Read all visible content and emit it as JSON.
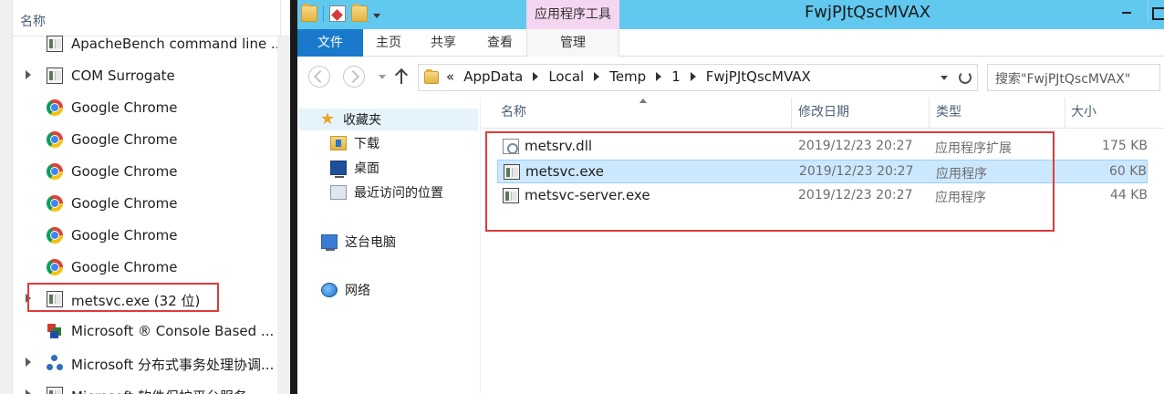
{
  "task_manager": {
    "column_header": "名称",
    "rows": [
      {
        "name": "ApacheBench command line ...",
        "icon": "app-window-icon",
        "expandable": false
      },
      {
        "name": "COM Surrogate",
        "icon": "app-window-icon",
        "expandable": true
      },
      {
        "name": "Google Chrome",
        "icon": "chrome-icon",
        "expandable": false
      },
      {
        "name": "Google Chrome",
        "icon": "chrome-icon",
        "expandable": false
      },
      {
        "name": "Google Chrome",
        "icon": "chrome-icon",
        "expandable": false
      },
      {
        "name": "Google Chrome",
        "icon": "chrome-icon",
        "expandable": false
      },
      {
        "name": "Google Chrome",
        "icon": "chrome-icon",
        "expandable": false
      },
      {
        "name": "Google Chrome",
        "icon": "chrome-icon",
        "expandable": false
      },
      {
        "name": "metsvc.exe (32 位)",
        "icon": "app-window-icon",
        "expandable": true,
        "highlighted": true
      },
      {
        "name": "Microsoft ® Console Based ...",
        "icon": "ms-console-icon",
        "expandable": false
      },
      {
        "name": "Microsoft 分布式事务处理协调...",
        "icon": "network-nodes-icon",
        "expandable": true
      },
      {
        "name": "Microsoft 软件保护平台服务",
        "icon": "app-window-icon",
        "expandable": true
      }
    ],
    "highlight_color": "#e03a3a"
  },
  "explorer": {
    "window_title": "FwjPJtQscMVAX",
    "contextual_group": "应用程序工具",
    "ribbon_tabs": {
      "file": "文件",
      "home": "主页",
      "share": "共享",
      "view": "查看",
      "manage": "管理"
    },
    "breadcrumb_prefix": "«",
    "breadcrumb": [
      "AppData",
      "Local",
      "Temp",
      "1",
      "FwjPJtQscMVAX"
    ],
    "search_placeholder": "搜索\"FwjPJtQscMVAX\"",
    "nav_pane": {
      "favorites": "收藏夹",
      "downloads": "下载",
      "desktop": "桌面",
      "recent": "最近访问的位置",
      "this_pc": "这台电脑",
      "network": "网络"
    },
    "columns": {
      "name": "名称",
      "modified": "修改日期",
      "type": "类型",
      "size": "大小"
    },
    "files": [
      {
        "name": "metsrv.dll",
        "modified": "2019/12/23 20:27",
        "type": "应用程序扩展",
        "size": "175 KB",
        "icon": "dll-icon",
        "selected": false
      },
      {
        "name": "metsvc.exe",
        "modified": "2019/12/23 20:27",
        "type": "应用程序",
        "size": "60 KB",
        "icon": "app-window-icon",
        "selected": true
      },
      {
        "name": "metsvc-server.exe",
        "modified": "2019/12/23 20:27",
        "type": "应用程序",
        "size": "44 KB",
        "icon": "app-window-icon",
        "selected": false
      }
    ],
    "colors": {
      "titlebar": "#61c8ef",
      "file_tab": "#1979ca",
      "context_tab": "#f5d6f0",
      "selection": "#cce8ff"
    }
  }
}
